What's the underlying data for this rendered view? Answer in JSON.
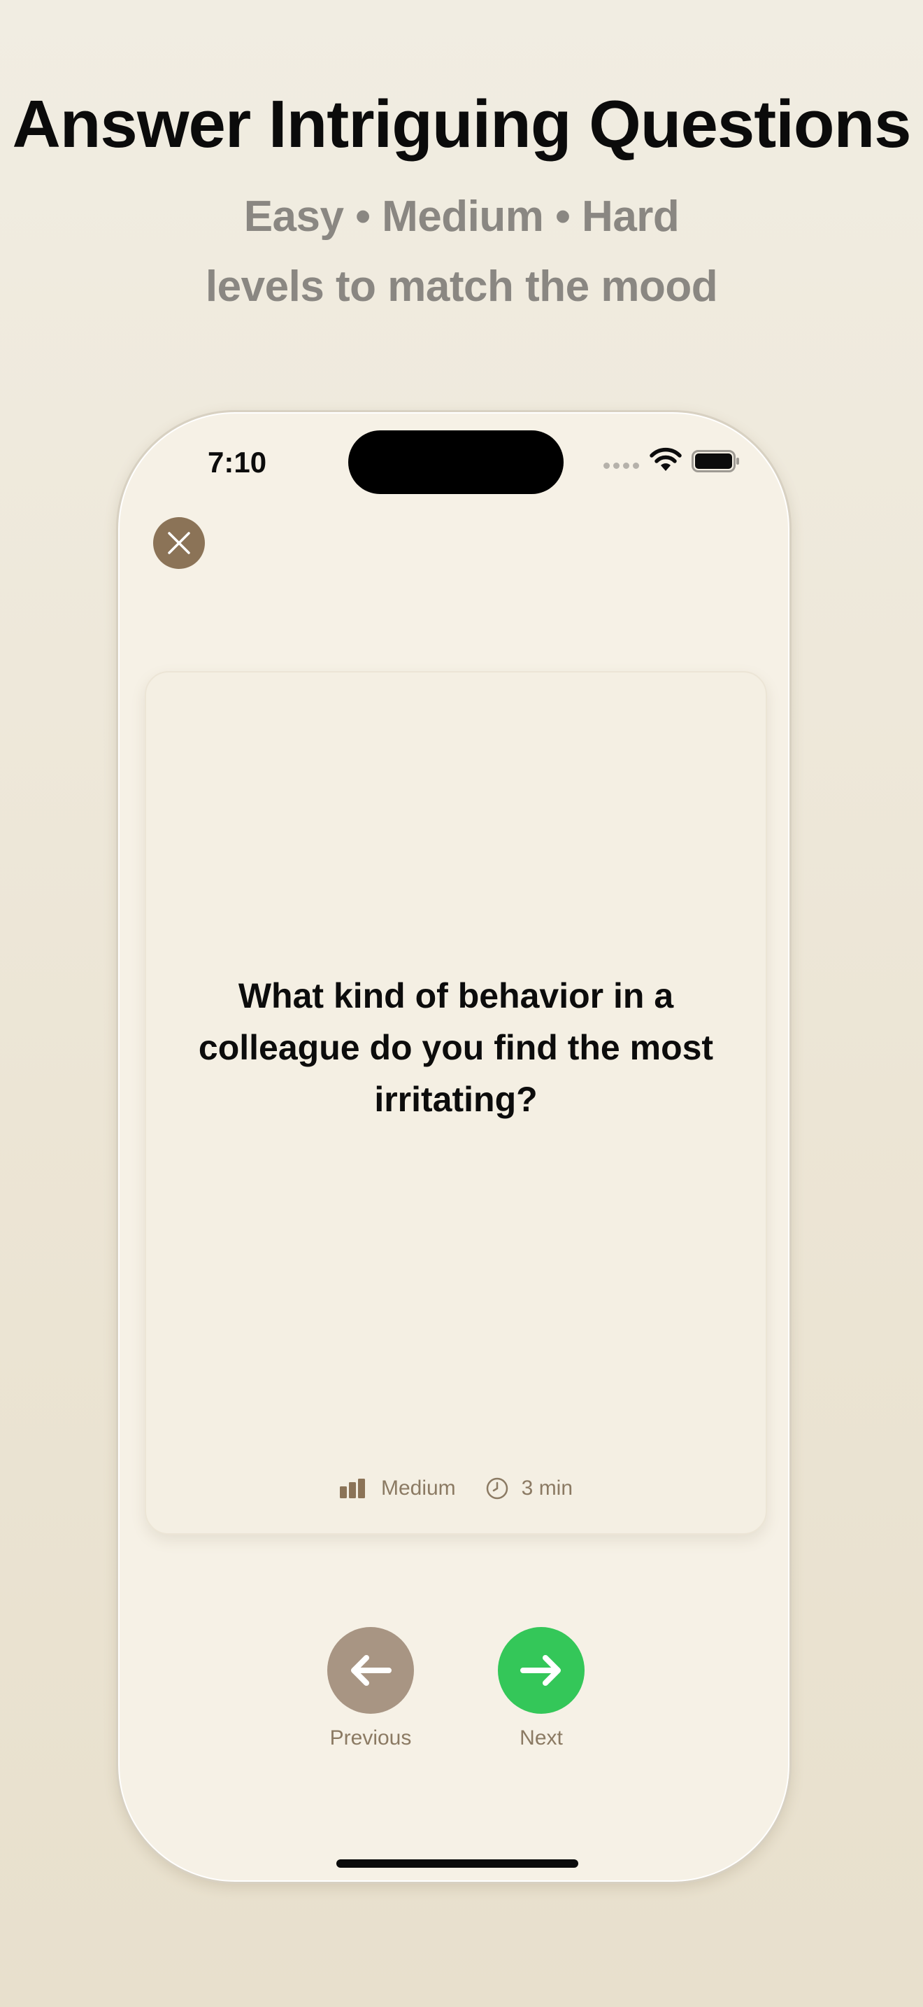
{
  "promo": {
    "headline": "Answer Intriguing Questions",
    "subline_1": "Easy • Medium • Hard",
    "subline_2": "levels to match the mood"
  },
  "status_bar": {
    "time": "7:10"
  },
  "card": {
    "question": "What kind of behavior in a colleague do you find the most irritating?",
    "difficulty": "Medium",
    "duration": "3 min"
  },
  "navigation": {
    "previous_label": "Previous",
    "next_label": "Next"
  },
  "colors": {
    "close_button": "#8b7357",
    "previous_button": "#a89583",
    "next_button": "#34c759",
    "meta_text": "#8b7a63"
  },
  "icons": {
    "close": "close-icon",
    "previous": "arrow-left-icon",
    "next": "arrow-right-icon",
    "difficulty": "bar-chart-icon",
    "duration": "clock-icon"
  }
}
